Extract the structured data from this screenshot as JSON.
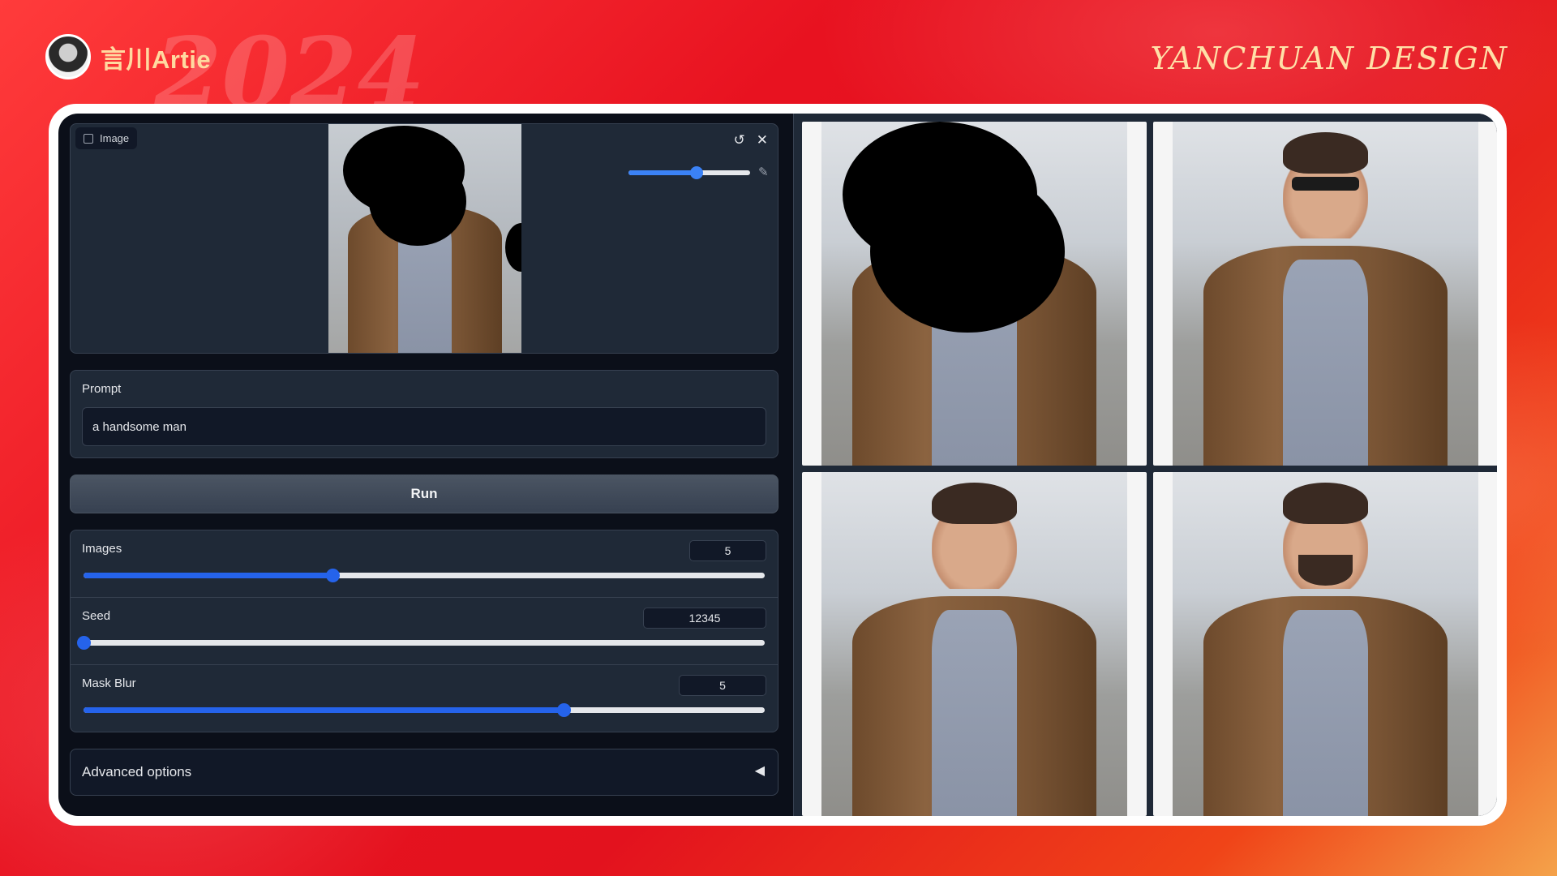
{
  "branding": {
    "name": "言川Artie",
    "signature": "YANCHUAN DESIGN",
    "year_watermark": "2024"
  },
  "image_input": {
    "tag": "Image",
    "undo_icon": "undo-icon",
    "close_icon": "close-icon",
    "brush_icon": "brush-icon",
    "brush_size_fraction": 0.56
  },
  "prompt": {
    "label": "Prompt",
    "value": "a handsome man"
  },
  "run_button": {
    "label": "Run"
  },
  "sliders": [
    {
      "label": "Images",
      "value": "5",
      "fraction": 0.365
    },
    {
      "label": "Seed",
      "value": "12345",
      "fraction": 0.0
    },
    {
      "label": "Mask Blur",
      "value": "5",
      "fraction": 0.705
    }
  ],
  "advanced": {
    "label": "Advanced options",
    "arrow_icon": "triangle-left-icon"
  },
  "gallery": {
    "images": [
      {
        "variant": "masked"
      },
      {
        "variant": "sunglasses"
      },
      {
        "variant": "clean-shaven"
      },
      {
        "variant": "bearded"
      }
    ]
  },
  "colors": {
    "accent": "#2563eb",
    "panel": "#1f2937",
    "app_bg": "#0b0f19"
  }
}
